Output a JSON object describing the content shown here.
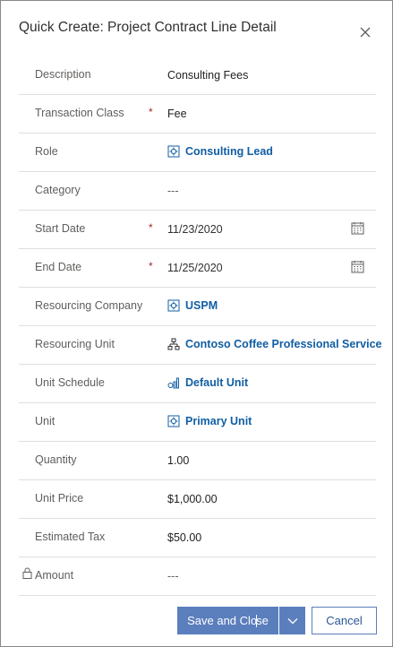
{
  "window": {
    "title": "Quick Create: Project Contract Line Detail",
    "close_icon": "close-icon"
  },
  "fields": {
    "description": {
      "label": "Description",
      "value": "Consulting Fees"
    },
    "transaction_class": {
      "label": "Transaction Class",
      "required_marker": "*",
      "value": "Fee"
    },
    "role": {
      "label": "Role",
      "value": "Consulting Lead",
      "icon": "entity-icon"
    },
    "category": {
      "label": "Category",
      "value": "---"
    },
    "start_date": {
      "label": "Start Date",
      "required_marker": "*",
      "value": "11/23/2020",
      "icon": "calendar-icon"
    },
    "end_date": {
      "label": "End Date",
      "required_marker": "*",
      "value": "11/25/2020",
      "icon": "calendar-icon"
    },
    "resourcing_company": {
      "label": "Resourcing Company",
      "value": "USPM",
      "icon": "entity-icon"
    },
    "resourcing_unit": {
      "label": "Resourcing Unit",
      "value": "Contoso Coffee Professional Service",
      "icon": "org-hierarchy-icon"
    },
    "unit_schedule": {
      "label": "Unit Schedule",
      "value": "Default Unit",
      "icon": "unit-schedule-icon"
    },
    "unit": {
      "label": "Unit",
      "value": "Primary Unit",
      "icon": "entity-icon"
    },
    "quantity": {
      "label": "Quantity",
      "value": "1.00"
    },
    "unit_price": {
      "label": "Unit Price",
      "value": "$1,000.00"
    },
    "estimated_tax": {
      "label": "Estimated Tax",
      "value": "$50.00"
    },
    "amount": {
      "label": "Amount",
      "value": "---",
      "icon": "lock-icon"
    }
  },
  "footer": {
    "save_and_close_label_part1": "Save and Clo",
    "save_and_close_label_part2": "se",
    "cancel_label": "Cancel",
    "split_icon": "chevron-down-icon"
  },
  "colors": {
    "primary_button": "#5b7ebd",
    "link": "#115ea3",
    "required": "#a4262c",
    "divider": "#e1dfdd"
  }
}
